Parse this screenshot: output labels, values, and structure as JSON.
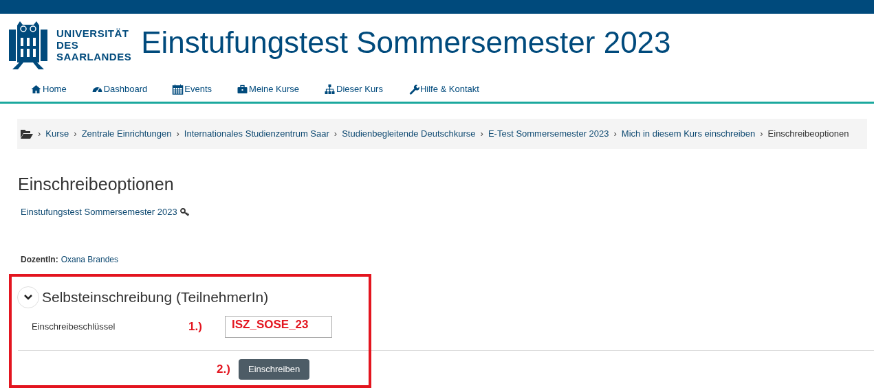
{
  "header": {
    "logo_text": [
      "UNIVERSITÄT",
      "DES",
      "SAARLANDES"
    ],
    "title": "Einstufungstest Sommersemester 2023"
  },
  "nav": [
    {
      "label": "Home"
    },
    {
      "label": "Dashboard"
    },
    {
      "label": "Events"
    },
    {
      "label": "Meine Kurse"
    },
    {
      "label": "Dieser Kurs"
    },
    {
      "label": "Hilfe & Kontakt"
    }
  ],
  "breadcrumb": [
    {
      "separator": "›",
      "label": "Kurse",
      "link": true
    },
    {
      "separator": "›",
      "label": "Zentrale Einrichtungen",
      "link": true
    },
    {
      "separator": "›",
      "label": "Internationales Studienzentrum Saar",
      "link": true
    },
    {
      "separator": "›",
      "label": "Studienbegleitende Deutschkurse",
      "link": true
    },
    {
      "separator": "›",
      "label": "E-Test Sommersemester 2023",
      "link": true
    },
    {
      "separator": "›",
      "label": "Mich in diesem Kurs einschreiben",
      "link": true
    },
    {
      "separator": "›",
      "label": "Einschreibeoptionen",
      "link": false
    }
  ],
  "page_heading": "Einschreibeoptionen",
  "course_link": "Einstufungstest Sommersemester 2023",
  "teacher": {
    "label": "DozentIn:",
    "name": "Oxana Brandes"
  },
  "enrol_section": {
    "title": "Selbsteinschreibung (TeilnehmerIn)",
    "expanded": true,
    "field_label": "Einschreibeschlüssel",
    "field_value": "ISZ_SOSE_23",
    "button": "Einschreiben"
  },
  "annotations": {
    "step_1": "1.)",
    "step_2": "2.)"
  }
}
